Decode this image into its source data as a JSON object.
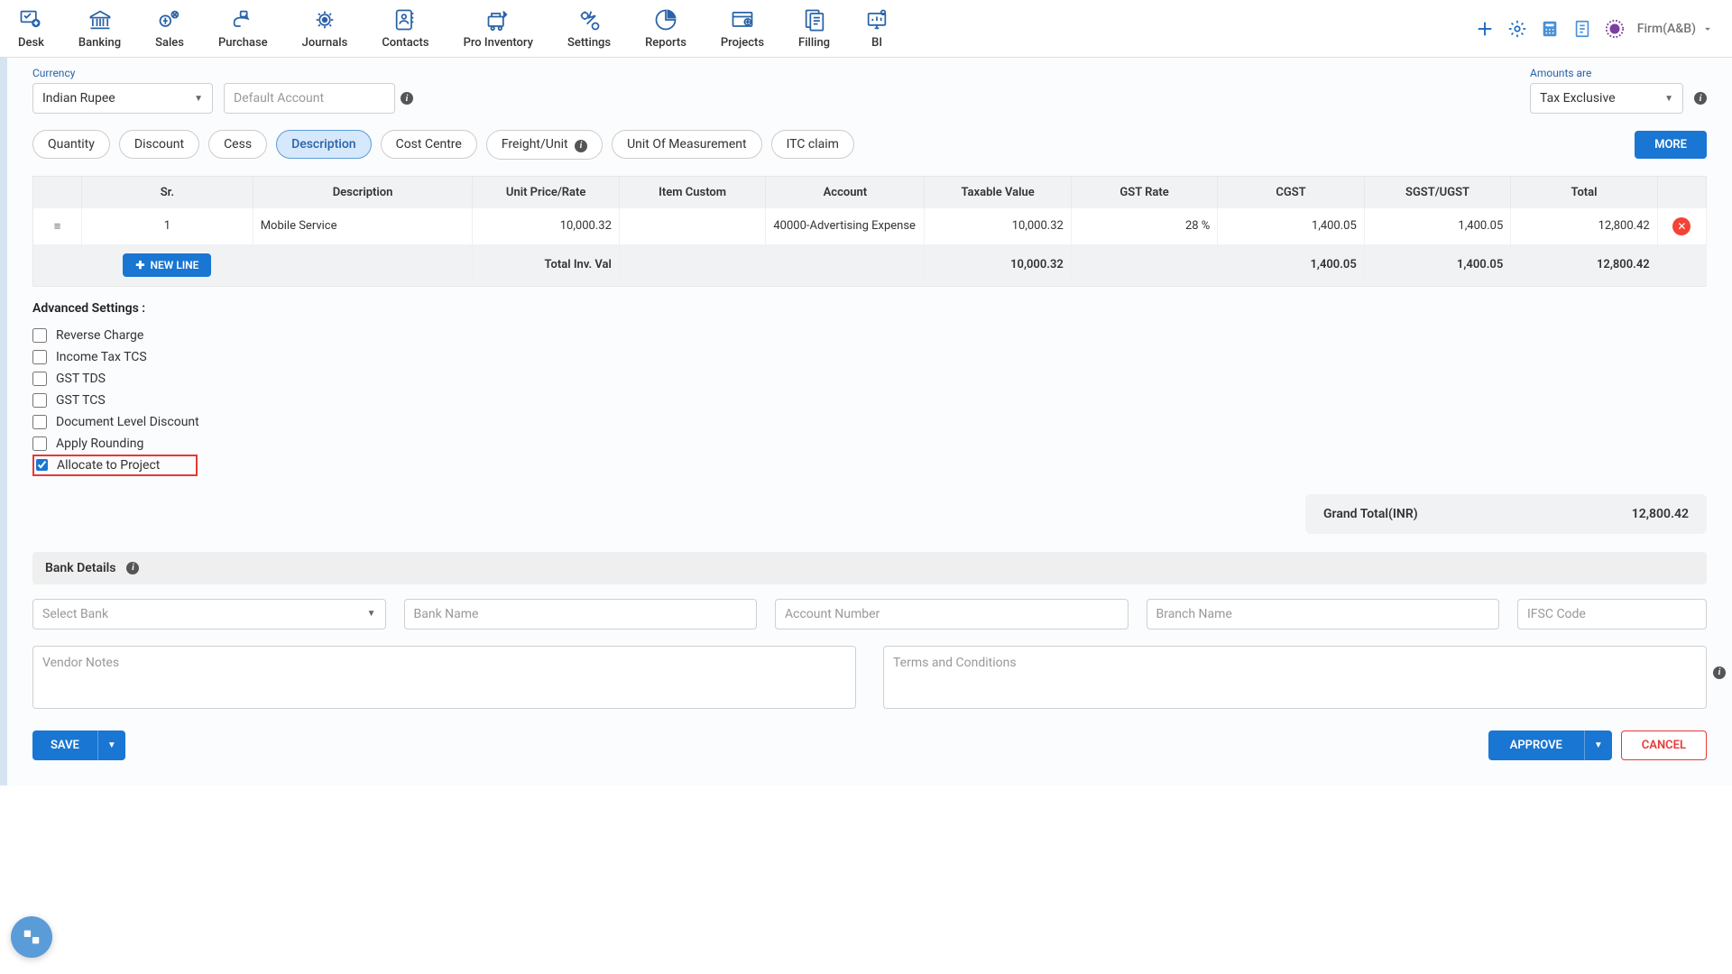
{
  "topnav": [
    "Desk",
    "Banking",
    "Sales",
    "Purchase",
    "Journals",
    "Contacts",
    "Pro Inventory",
    "Settings",
    "Reports",
    "Projects",
    "Filling",
    "BI"
  ],
  "firm": "Firm(A&B)",
  "currency": {
    "label": "Currency",
    "value": "Indian Rupee"
  },
  "defaultAccount": {
    "placeholder": "Default Account"
  },
  "amountsAre": {
    "label": "Amounts are",
    "value": "Tax Exclusive"
  },
  "pills": [
    "Quantity",
    "Discount",
    "Cess",
    "Description",
    "Cost Centre",
    "Freight/Unit",
    "Unit Of Measurement",
    "ITC claim"
  ],
  "activePill": "Description",
  "moreBtn": "MORE",
  "table": {
    "headers": [
      "",
      "Sr.",
      "Description",
      "Unit Price/Rate",
      "Item Custom",
      "Account",
      "Taxable Value",
      "GST Rate",
      "CGST",
      "SGST/UGST",
      "Total",
      ""
    ],
    "row": {
      "sr": "1",
      "description": "Mobile Service",
      "unitPrice": "10,000.32",
      "itemCustom": "",
      "account": "40000-Advertising Expense",
      "taxable": "10,000.32",
      "gstRate": "28 %",
      "cgst": "1,400.05",
      "sgst": "1,400.05",
      "total": "12,800.42"
    },
    "footer": {
      "newLine": "NEW LINE",
      "label": "Total Inv. Val",
      "taxable": "10,000.32",
      "cgst": "1,400.05",
      "sgst": "1,400.05",
      "total": "12,800.42"
    }
  },
  "advanced": {
    "title": "Advanced Settings :",
    "items": [
      "Reverse Charge",
      "Income Tax TCS",
      "GST TDS",
      "GST TCS",
      "Document Level Discount",
      "Apply Rounding",
      "Allocate to Project"
    ]
  },
  "grandTotal": {
    "label": "Grand Total(INR)",
    "value": "12,800.42"
  },
  "bank": {
    "header": "Bank Details",
    "selectPlaceholder": "Select Bank",
    "bankName": "Bank Name",
    "accountNumber": "Account Number",
    "branchName": "Branch Name",
    "ifsc": "IFSC Code"
  },
  "vendorNotes": "Vendor Notes",
  "terms": "Terms and Conditions",
  "buttons": {
    "save": "SAVE",
    "approve": "APPROVE",
    "cancel": "CANCEL"
  }
}
